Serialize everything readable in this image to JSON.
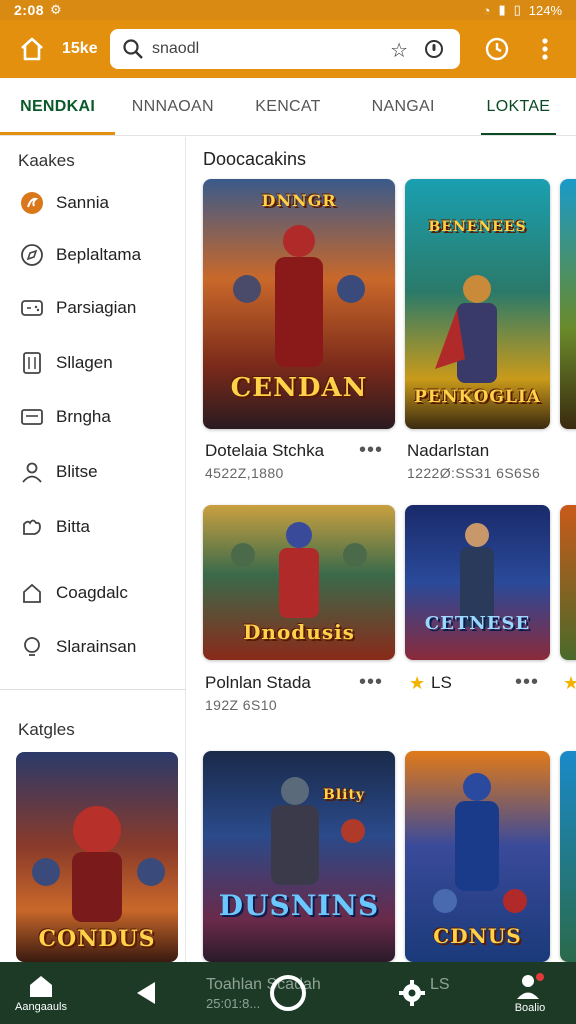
{
  "status_bar": {
    "time": "2:08",
    "battery": "124%"
  },
  "app_bar": {
    "brand": "15ke",
    "search_value": "snaodl"
  },
  "tabs": [
    {
      "label": "NENDKAI",
      "active": true
    },
    {
      "label": "NNNAOAN",
      "active": false
    },
    {
      "label": "KENCAT",
      "active": false
    },
    {
      "label": "NANGAI",
      "active": false
    },
    {
      "label": "LOKTAE",
      "active": false
    }
  ],
  "sidebar": {
    "heading": "Kaakes",
    "items": [
      {
        "label": "Sannia",
        "icon": "fire-icon"
      },
      {
        "label": "Beplaltama",
        "icon": "compass-icon"
      },
      {
        "label": "Parsiagian",
        "icon": "gamepad-icon"
      },
      {
        "label": "Sllagen",
        "icon": "building-icon"
      },
      {
        "label": "Brngha",
        "icon": "card-icon"
      },
      {
        "label": "Blitse",
        "icon": "person-icon"
      },
      {
        "label": "Bitta",
        "icon": "puzzle-icon"
      },
      {
        "label": "Coagdalc",
        "icon": "home-icon"
      },
      {
        "label": "Slarainsan",
        "icon": "bulb-icon"
      }
    ],
    "lower_heading": "Katgles",
    "lower_card_art": "CONDUS"
  },
  "main": {
    "heading": "Doocacakins",
    "cards": [
      {
        "title": "Dotelaia Stchka",
        "sub": "4522Z,1880",
        "art_top": "DNNGR",
        "art_title": "CENDAN"
      },
      {
        "title": "Nadarlstan",
        "sub": "1222Ø:SSЗ1 6S6S6",
        "art_top": "BENENEES",
        "art_title": "PENKOGLIA"
      },
      {
        "title": "Polnlan Stada",
        "sub": "192Z 6S10",
        "art_top": "",
        "art_title": "Dnodusis"
      },
      {
        "title": "LS",
        "sub": "",
        "art_top": "",
        "art_title": "CETNESE"
      },
      {
        "title": "Toahlan Scadah",
        "sub": "25:01:8...",
        "art_top": "Blity",
        "art_title": "DUSNINS"
      },
      {
        "title": "LS",
        "sub": "",
        "art_top": "",
        "art_title": "CDNUS"
      }
    ]
  },
  "bottom_nav": {
    "home_label": "Aangaauls",
    "profile_label": "Boalio"
  },
  "colors": {
    "accent": "#e3900f",
    "nav_bg": "#1c3a26",
    "tab_active": "#0a5a2a"
  }
}
